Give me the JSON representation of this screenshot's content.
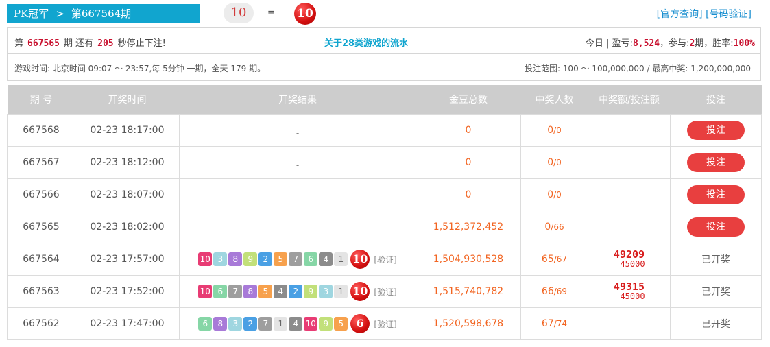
{
  "header": {
    "game_name": "PK冠军",
    "separator": ">",
    "issue_title": "第667564期",
    "sum_value": "10",
    "equals": "=",
    "result_value": "10",
    "links": [
      "[官方查询]",
      "[号码验证]"
    ]
  },
  "status": {
    "prefix": "第",
    "next_issue": "667565",
    "mid1": "期 还有",
    "seconds": "205",
    "suffix": "秒停止下注!",
    "center_link": "关于28类游戏的流水",
    "today_label": "今日 | 盈亏:",
    "profit": "8,524",
    "join_label": "，参与:",
    "join_count": "2",
    "join_unit": "期，胜率:",
    "win_rate": "100%"
  },
  "schedule": {
    "left": "游戏时间: 北京时间 09:07 ～ 23:57,每 5分钟 一期，全天 179 期。",
    "right": "投注范围: 100 ～ 100,000,000 / 最高中奖: 1,200,000,000"
  },
  "table": {
    "columns": [
      "期 号",
      "开奖时间",
      "开奖结果",
      "金豆总数",
      "中奖人数",
      "中奖额/投注额",
      "投注"
    ],
    "rows": [
      {
        "issue": "667568",
        "time": "02-23 18:17:00",
        "result_placeholder": "-",
        "total": "0",
        "winners": "0",
        "participants": "0",
        "action": "投注"
      },
      {
        "issue": "667567",
        "time": "02-23 18:12:00",
        "result_placeholder": "-",
        "total": "0",
        "winners": "0",
        "participants": "0",
        "action": "投注"
      },
      {
        "issue": "667566",
        "time": "02-23 18:07:00",
        "result_placeholder": "-",
        "total": "0",
        "winners": "0",
        "participants": "0",
        "action": "投注"
      },
      {
        "issue": "667565",
        "time": "02-23 18:02:00",
        "result_placeholder": "-",
        "total": "1,512,372,452",
        "winners": "0",
        "participants": "66",
        "action": "投注"
      },
      {
        "issue": "667564",
        "time": "02-23 17:57:00",
        "numbers": [
          "10",
          "3",
          "8",
          "9",
          "2",
          "5",
          "7",
          "6",
          "4",
          "1"
        ],
        "sum": "10",
        "verify": "[验证]",
        "total": "1,504,930,528",
        "winners": "65",
        "participants": "67",
        "win_amount": "49209",
        "bet_amount": "45000",
        "action": "已开奖"
      },
      {
        "issue": "667563",
        "time": "02-23 17:52:00",
        "numbers": [
          "10",
          "6",
          "7",
          "8",
          "5",
          "4",
          "2",
          "9",
          "3",
          "1"
        ],
        "sum": "10",
        "verify": "[验证]",
        "total": "1,515,740,782",
        "winners": "66",
        "participants": "69",
        "win_amount": "49315",
        "bet_amount": "45000",
        "action": "已开奖"
      },
      {
        "issue": "667562",
        "time": "02-23 17:47:00",
        "numbers": [
          "6",
          "8",
          "3",
          "2",
          "7",
          "1",
          "4",
          "10",
          "9",
          "5"
        ],
        "sum": "6",
        "verify": "[验证]",
        "total": "1,520,598,678",
        "winners": "67",
        "participants": "74",
        "win_amount": "",
        "bet_amount": "",
        "action": "已开奖"
      }
    ]
  },
  "colors": {
    "accent_blue": "#11a5cf",
    "bet_button": "#e83f3f",
    "highlight_red": "#c8102e",
    "orange_text": "#f26522",
    "header_gray": "#cdcdcd"
  }
}
